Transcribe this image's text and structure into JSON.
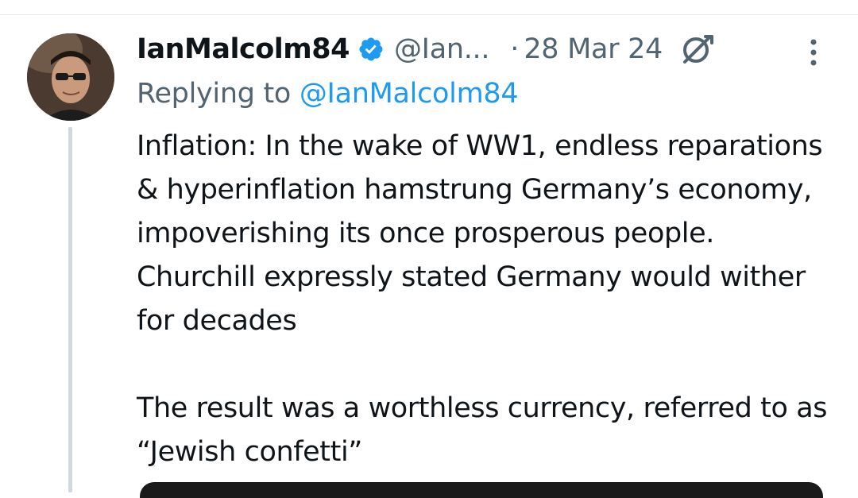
{
  "tweet": {
    "author": {
      "display_name": "IanMalcolm84",
      "handle": "@Ian...",
      "verified": true,
      "avatar_icon": "profile-photo"
    },
    "date": "28 Mar 24",
    "separator": "·",
    "replying_prefix": "Replying to ",
    "replying_to": "@IanMalcolm84",
    "body": {
      "paragraph1": "Inflation: In the wake of WW1, endless reparations & hyperinflation hamstrung Germany’s economy, impoverishing its once prosperous people. Churchill expressly stated Germany would wither for decades",
      "paragraph2": "The result was a worthless currency, referred to as “Jewish confetti”"
    },
    "icons": {
      "verified": "verified-badge-icon",
      "grok": "grok-icon",
      "more": "more-options-icon"
    }
  },
  "colors": {
    "text_primary": "#0f1419",
    "text_secondary": "#536471",
    "link": "#1d9bf0",
    "verified_badge": "#1d9bf0",
    "thread_line": "#cfd9de"
  }
}
